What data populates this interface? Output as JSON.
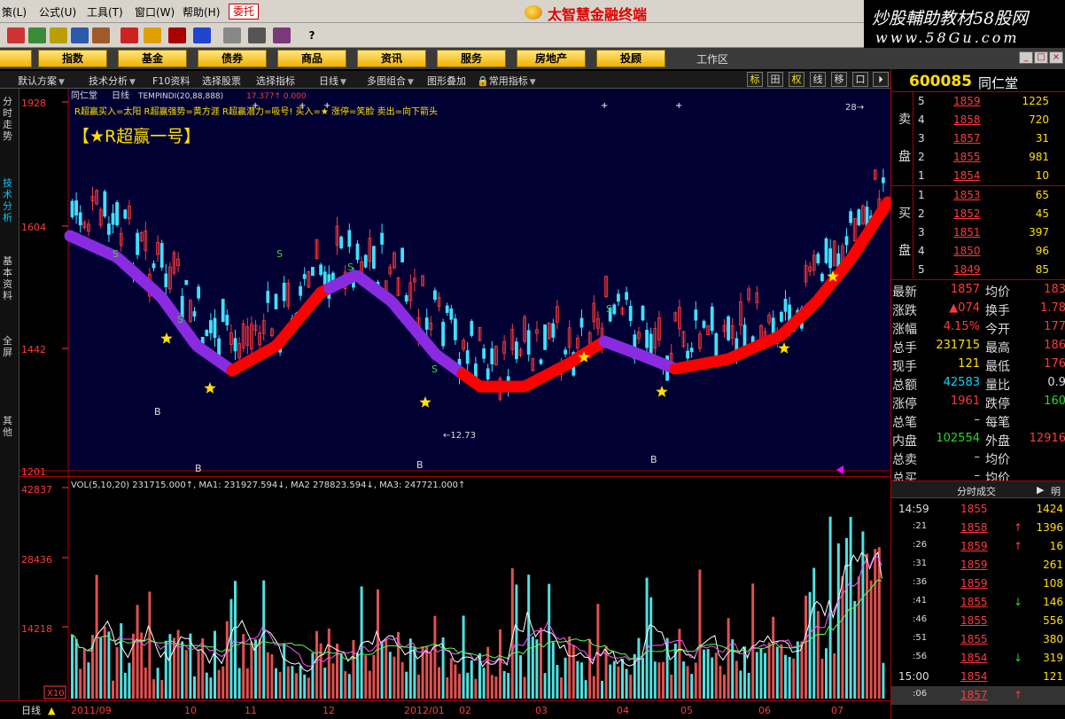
{
  "menu": {
    "items": [
      "策(L)",
      "公式(U)",
      "工具(T)",
      "窗口(W)",
      "帮助(H)"
    ],
    "trade_label": "委托",
    "brand": "太智慧金融终端"
  },
  "watermark": {
    "line1": "炒股輔助教材58股网",
    "line2": "www.58Gu.com"
  },
  "categories": [
    "股",
    "指数",
    "基金",
    "债券",
    "商品",
    "资讯",
    "服务",
    "房地产",
    "投顾"
  ],
  "work_area": "工作区",
  "chart_toolbar": {
    "items": [
      "默认方案",
      "技术分析",
      "F10资料",
      "选择股票",
      "选择指标",
      "日线",
      "多图组合",
      "图形叠加",
      "常用指标"
    ],
    "icons": [
      "标",
      "田",
      "权",
      "线",
      "移",
      "口",
      "⏵"
    ]
  },
  "left_tabs": [
    "分时走势",
    "技术分析",
    "基本资料",
    "全屏",
    "其他"
  ],
  "price_chart": {
    "header_name": "同仁堂",
    "header_period": "日线",
    "header_indicator": "TEMPINDI(20,88,888)",
    "header_values": "17.377↑  0.000",
    "legend_text": "R超赢买入=太阳  R超赢强势=黄方涯  R超赢潜力=吸号!  买入=★  涨停=笑脸  卖出=向下箭头",
    "big_title": "【★R超赢一号】",
    "y_labels": [
      "1928",
      "1604",
      "1442",
      "1201"
    ],
    "low_label": "←12.73",
    "high_label": "28→"
  },
  "volume_chart": {
    "header": "VOL(5,10,20)  231715.000↑, MA1: 231927.594↓, MA2  278823.594↓, MA3: 247721.000↑",
    "y_labels": [
      "42837",
      "28436",
      "14218"
    ],
    "unit_label": "X10"
  },
  "bottom": {
    "period": "日线",
    "x_labels": [
      "2011/09",
      "10",
      "11",
      "12",
      "2012/01",
      "02",
      "03",
      "04",
      "05",
      "06",
      "07"
    ]
  },
  "quote": {
    "code": "600085",
    "name": "同仁堂",
    "sell_label": [
      "卖",
      "盘"
    ],
    "buy_label": [
      "买",
      "盘"
    ],
    "asks": [
      {
        "lvl": "5",
        "price": "1859",
        "vol": "1225"
      },
      {
        "lvl": "4",
        "price": "1858",
        "vol": "720"
      },
      {
        "lvl": "3",
        "price": "1857",
        "vol": "31"
      },
      {
        "lvl": "2",
        "price": "1855",
        "vol": "981"
      },
      {
        "lvl": "1",
        "price": "1854",
        "vol": "10"
      }
    ],
    "bids": [
      {
        "lvl": "1",
        "price": "1853",
        "vol": "65"
      },
      {
        "lvl": "2",
        "price": "1852",
        "vol": "45"
      },
      {
        "lvl": "3",
        "price": "1851",
        "vol": "397"
      },
      {
        "lvl": "4",
        "price": "1850",
        "vol": "96"
      },
      {
        "lvl": "5",
        "price": "1849",
        "vol": "85"
      }
    ],
    "stats": [
      {
        "k1": "最新",
        "v1": "1857",
        "k2": "均价",
        "v2": "183"
      },
      {
        "k1": "涨跌",
        "v1": "▲074",
        "k2": "换手",
        "v2": "1.78"
      },
      {
        "k1": "涨幅",
        "v1": "4.15%",
        "k2": "今开",
        "v2": "177"
      },
      {
        "k1": "总手",
        "v1": "231715",
        "k2": "最高",
        "v2": "186"
      },
      {
        "k1": "现手",
        "v1": "121",
        "k2": "最低",
        "v2": "176"
      },
      {
        "k1": "总额",
        "v1": "42583",
        "k2": "量比",
        "v2": "0.9"
      },
      {
        "k1": "涨停",
        "v1": "1961",
        "k2": "跌停",
        "v2": "160"
      },
      {
        "k1": "总笔",
        "v1": "–",
        "k2": "每笔",
        "v2": ""
      },
      {
        "k1": "内盘",
        "v1": "102554",
        "k2": "外盘",
        "v2": "12916"
      },
      {
        "k1": "总卖",
        "v1": "–",
        "k2": "均价",
        "v2": ""
      },
      {
        "k1": "总买",
        "v1": "–",
        "k2": "均价",
        "v2": ""
      }
    ],
    "ticks_title": "分时成交",
    "ticks_more": "明",
    "ticks": [
      {
        "t": "14:59",
        "p": "1855",
        "v": "1424",
        "d": ""
      },
      {
        "t": ":21",
        "p": "1858",
        "v": "1396",
        "d": "up"
      },
      {
        "t": ":26",
        "p": "1859",
        "v": "16",
        "d": "up"
      },
      {
        "t": ":31",
        "p": "1859",
        "v": "261",
        "d": ""
      },
      {
        "t": ":36",
        "p": "1859",
        "v": "108",
        "d": ""
      },
      {
        "t": ":41",
        "p": "1855",
        "v": "146",
        "d": "down"
      },
      {
        "t": ":46",
        "p": "1855",
        "v": "556",
        "d": ""
      },
      {
        "t": ":51",
        "p": "1855",
        "v": "380",
        "d": ""
      },
      {
        "t": ":56",
        "p": "1854",
        "v": "319",
        "d": "down"
      },
      {
        "t": "15:00",
        "p": "1854",
        "v": "121",
        "d": ""
      },
      {
        "t": ":06",
        "p": "1857",
        "v": "",
        "d": "up"
      }
    ]
  }
}
